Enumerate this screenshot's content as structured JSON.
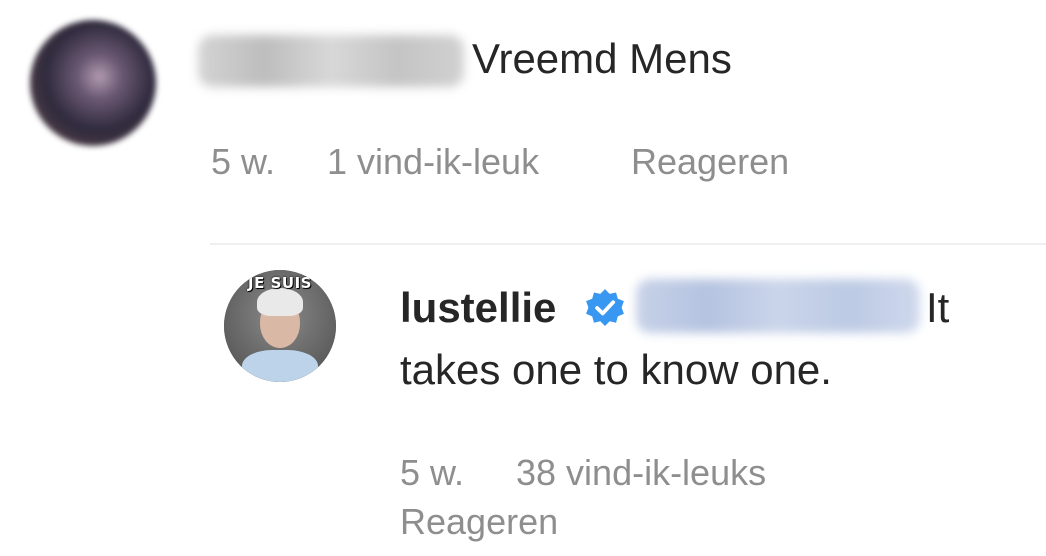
{
  "comment": {
    "avatar_icon": "user-avatar-blurred",
    "username_redacted": true,
    "text": "Vreemd Mens",
    "time": "5 w.",
    "likes": "1 vind-ik-leuk",
    "reply_label": "Reageren"
  },
  "reply": {
    "avatar_caption": "JE SUIS",
    "username": "lustellie",
    "verified_icon": "verified-badge-icon",
    "verified_color": "#3897f0",
    "mention_redacted": true,
    "text_line1": "It",
    "text_line2": "takes one to know one.",
    "time": "5 w.",
    "likes": "38 vind-ik-leuks",
    "reply_label": "Reageren"
  }
}
